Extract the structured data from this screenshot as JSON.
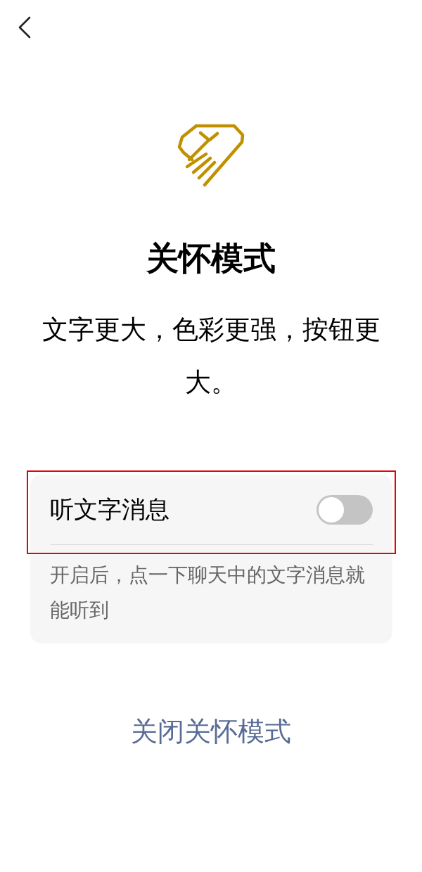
{
  "title": "关怀模式",
  "subtitle": "文字更大，色彩更强，按钮更大。",
  "setting": {
    "label": "听文字消息",
    "on": false,
    "highlighted": true,
    "description": "开启后，点一下聊天中的文字消息就能听到"
  },
  "action": {
    "label": "关闭关怀模式"
  }
}
